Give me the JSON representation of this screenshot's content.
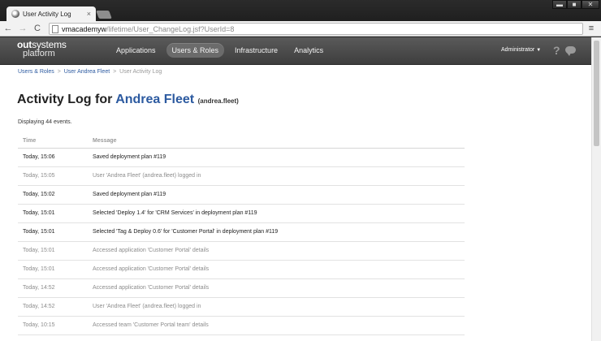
{
  "browser": {
    "tab_title": "User Activity Log",
    "tab_close": "×",
    "url_host": "vmacademyw",
    "url_path": "/lifetime/User_ChangeLog.jsf?UserId=8",
    "window_controls": {
      "minimize": "▬",
      "maximize": "■",
      "close": "✕"
    },
    "nav": {
      "back": "←",
      "forward": "→",
      "reload": "C"
    },
    "menu": "≡"
  },
  "app": {
    "logo_line1_bold": "out",
    "logo_line1_rest": "systems",
    "logo_line2": "platform",
    "nav": [
      {
        "label": "Applications",
        "active": false
      },
      {
        "label": "Users & Roles",
        "active": true
      },
      {
        "label": "Infrastructure",
        "active": false
      },
      {
        "label": "Analytics",
        "active": false
      }
    ],
    "user_menu": "Administrator",
    "help": "?"
  },
  "breadcrumb": {
    "items": [
      "Users & Roles",
      "User Andrea Fleet",
      "User Activity Log"
    ],
    "separator": ">"
  },
  "title": {
    "prefix": "Activity Log for",
    "user_name": "Andrea Fleet",
    "user_handle": "(andrea.fleet)"
  },
  "event_count": "Displaying 44 events.",
  "table": {
    "columns": [
      "Time",
      "Message"
    ],
    "rows": [
      {
        "time": "Today, 15:06",
        "message": "Saved deployment plan #119",
        "strong": true
      },
      {
        "time": "Today, 15:05",
        "message": "User 'Andrea Fleet' (andrea.fleet) logged in",
        "strong": false
      },
      {
        "time": "Today, 15:02",
        "message": "Saved deployment plan #119",
        "strong": true
      },
      {
        "time": "Today, 15:01",
        "message": "Selected 'Deploy 1.4' for 'CRM Services' in deployment plan #119",
        "strong": true
      },
      {
        "time": "Today, 15:01",
        "message": "Selected 'Tag & Deploy 0.6' for 'Customer Portal' in deployment plan #119",
        "strong": true
      },
      {
        "time": "Today, 15:01",
        "message": "Accessed application 'Customer Portal' details",
        "strong": false
      },
      {
        "time": "Today, 15:01",
        "message": "Accessed application 'Customer Portal' details",
        "strong": false
      },
      {
        "time": "Today, 14:52",
        "message": "Accessed application 'Customer Portal' details",
        "strong": false
      },
      {
        "time": "Today, 14:52",
        "message": "User 'Andrea Fleet' (andrea.fleet) logged in",
        "strong": false
      },
      {
        "time": "Today, 10:15",
        "message": "Accessed team 'Customer Portal team' details",
        "strong": false
      }
    ]
  },
  "colors": {
    "link": "#2c5aa0",
    "header_bg": "#4a4a4a",
    "muted_text": "#8c8c8c"
  }
}
